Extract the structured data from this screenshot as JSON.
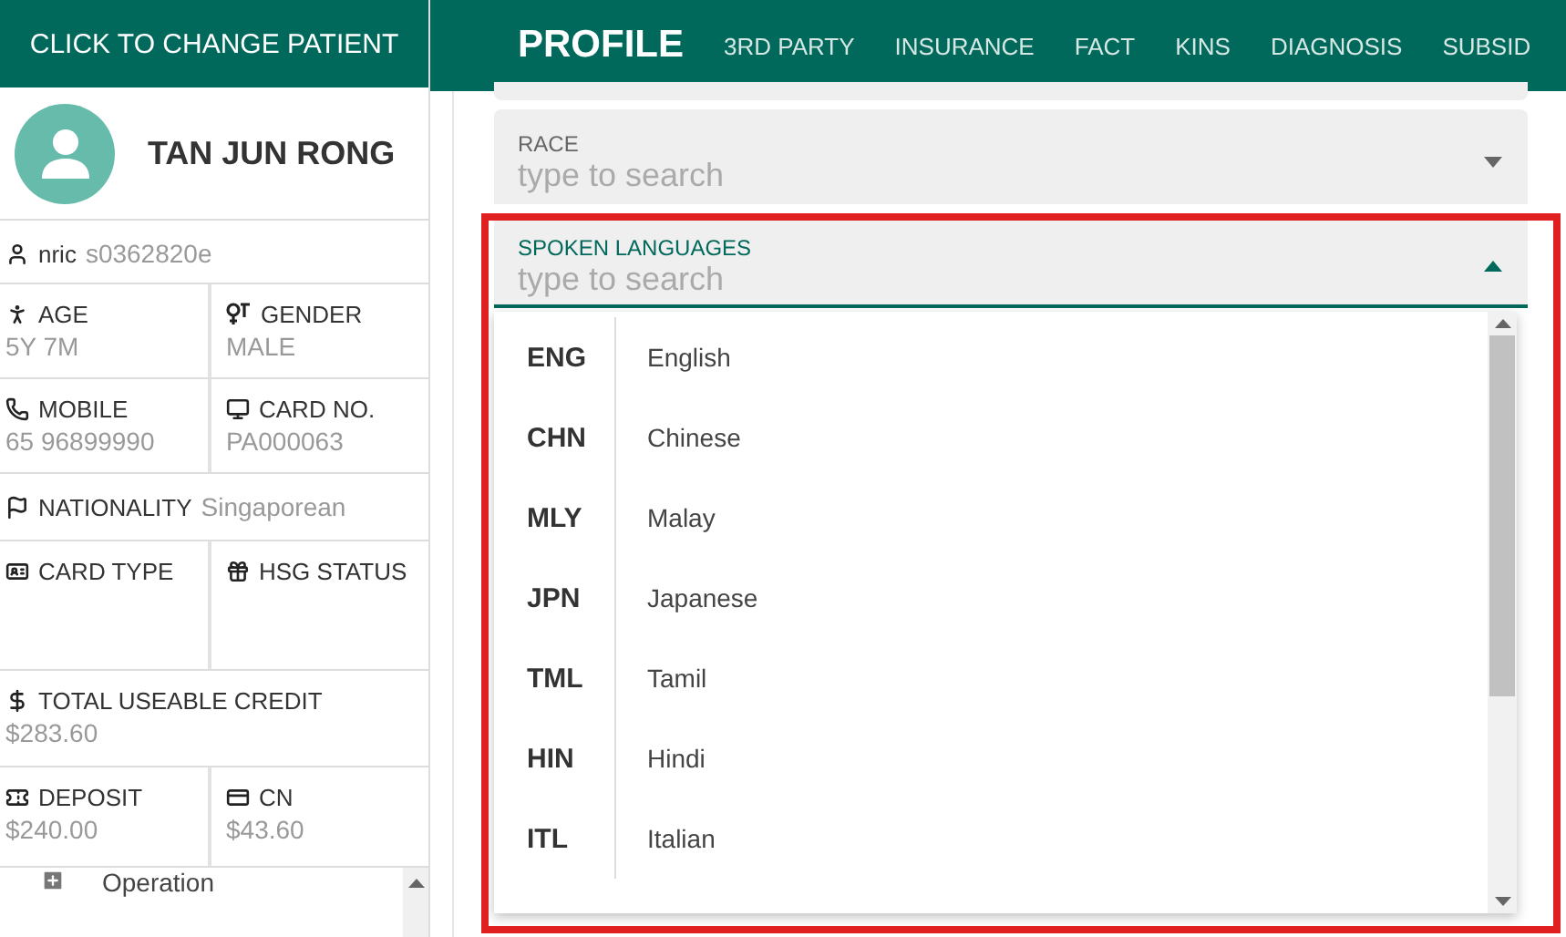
{
  "sidebar": {
    "header": "CLICK TO CHANGE PATIENT",
    "patient_name": "TAN JUN RONG",
    "info_rows": [
      {
        "cells": [
          {
            "kind": "inline",
            "label": "nric",
            "value": "s0362820e"
          }
        ]
      },
      {
        "cells": [
          {
            "kind": "stacked",
            "label": "AGE",
            "value": "5Y 7M"
          },
          {
            "kind": "stacked",
            "label": "GENDER",
            "value": "MALE"
          }
        ]
      },
      {
        "cells": [
          {
            "kind": "stacked",
            "label": "MOBILE",
            "value": "65 96899990"
          },
          {
            "kind": "stacked",
            "label": "CARD NO.",
            "value": "PA000063"
          }
        ]
      },
      {
        "cells": [
          {
            "kind": "inline",
            "label": "NATIONALITY",
            "value": "Singaporean"
          }
        ]
      },
      {
        "cells": [
          {
            "kind": "stacked",
            "label": "CARD TYPE"
          },
          {
            "kind": "stacked",
            "label": "HSG STATUS"
          }
        ]
      },
      {
        "cells": [
          {
            "kind": "stacked",
            "label": "TOTAL USEABLE CREDIT",
            "value": "$283.60"
          }
        ]
      },
      {
        "cells": [
          {
            "kind": "stacked",
            "label": "DEPOSIT",
            "value": "$240.00"
          },
          {
            "kind": "stacked",
            "label": "CN",
            "value": "$43.60"
          }
        ]
      }
    ],
    "menu": [
      {
        "label": "Operation"
      }
    ]
  },
  "tabs": [
    {
      "label": "PROFILE",
      "selected": true
    },
    {
      "label": "3RD PARTY",
      "selected": false
    },
    {
      "label": "INSURANCE",
      "selected": false
    },
    {
      "label": "FACT",
      "selected": false
    },
    {
      "label": "KINS",
      "selected": false
    },
    {
      "label": "DIAGNOSIS",
      "selected": false
    },
    {
      "label": "SUBSID",
      "selected": false
    }
  ],
  "form": {
    "fields": [
      {
        "label": "RACE",
        "placeholder": "type to search",
        "expanded": false
      },
      {
        "label": "SPOKEN LANGUAGES",
        "placeholder": "type to search",
        "expanded": true
      }
    ],
    "options": [
      {
        "code": "ENG",
        "name": "English"
      },
      {
        "code": "CHN",
        "name": "Chinese"
      },
      {
        "code": "MLY",
        "name": "Malay"
      },
      {
        "code": "JPN",
        "name": "Japanese"
      },
      {
        "code": "TML",
        "name": "Tamil"
      },
      {
        "code": "HIN",
        "name": "Hindi"
      },
      {
        "code": "ITL",
        "name": "Italian"
      }
    ]
  }
}
